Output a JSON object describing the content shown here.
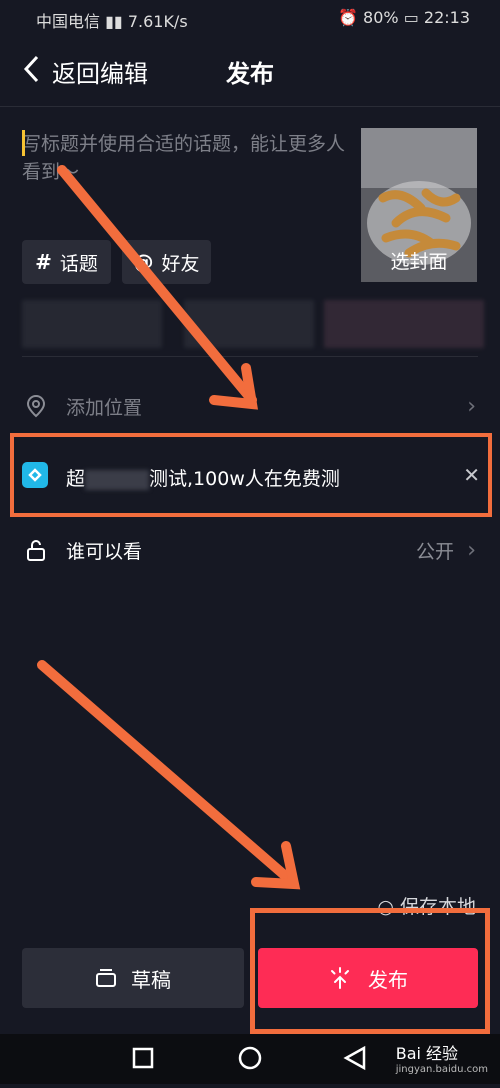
{
  "status_bar": {
    "carrier": "中国电信",
    "network_speed": "7.61K/s",
    "battery": "80%",
    "time": "22:13"
  },
  "header": {
    "back_label": "返回编辑",
    "title": "发布"
  },
  "caption": {
    "placeholder": "写标题并使用合适的话题，能让更多人看到～"
  },
  "cover": {
    "label": "选封面"
  },
  "chips": {
    "topic_symbol": "#",
    "topic": "话题",
    "friend_symbol": "@",
    "friend": "好友"
  },
  "location": {
    "label": "添加位置"
  },
  "promo": {
    "text_prefix": "超",
    "text_suffix": "测试,100w人在免费测"
  },
  "privacy": {
    "label": "谁可以看",
    "value": "公开"
  },
  "actions": {
    "save_local": "保存本地",
    "draft": "草稿",
    "publish": "发布"
  },
  "watermark": {
    "brand": "Bai 经验",
    "url": "jingyan.baidu.com"
  },
  "colors": {
    "background": "#161823",
    "accent": "#fe2c55",
    "annotation": "#f26d3d"
  }
}
